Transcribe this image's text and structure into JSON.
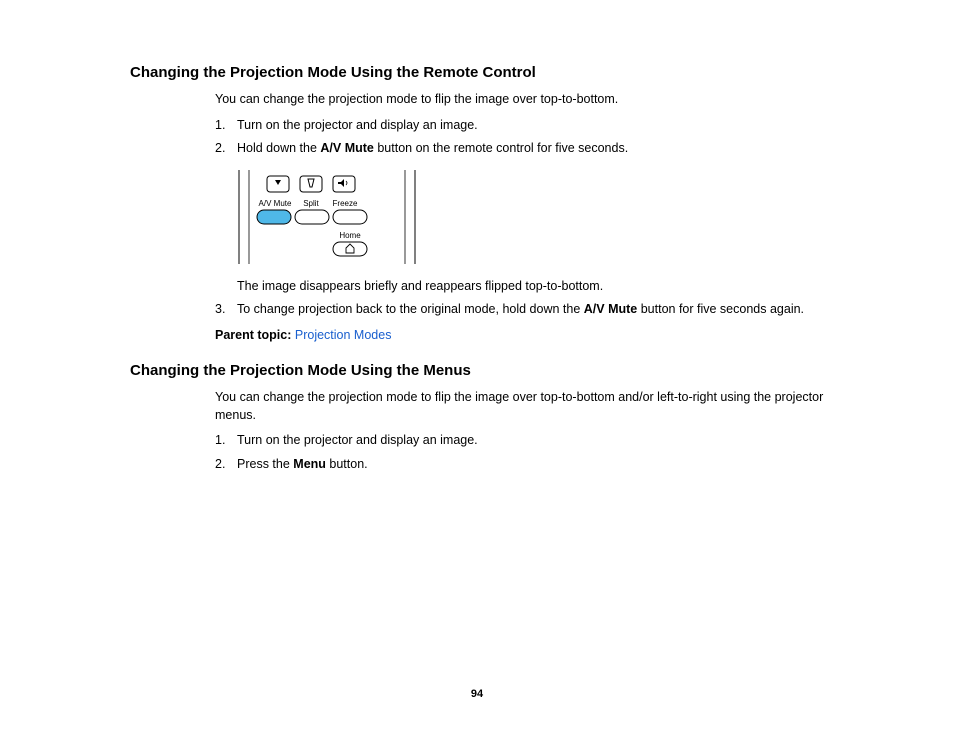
{
  "section1": {
    "heading": "Changing the Projection Mode Using the Remote Control",
    "intro": "You can change the projection mode to flip the image over top-to-bottom.",
    "step1_num": "1.",
    "step1": "Turn on the projector and display an image.",
    "step2_num": "2.",
    "step2_pre": "Hold down the ",
    "step2_bold": "A/V Mute",
    "step2_post": " button on the remote control for five seconds.",
    "after_figure": "The image disappears briefly and reappears flipped top-to-bottom.",
    "step3_num": "3.",
    "step3_pre": "To change projection back to the original mode, hold down the ",
    "step3_bold": "A/V Mute",
    "step3_post": " button for five seconds again.",
    "parent_label": "Parent topic: ",
    "parent_link": "Projection Modes"
  },
  "remote": {
    "avmute": "A/V Mute",
    "split": "Split",
    "freeze": "Freeze",
    "home": "Home"
  },
  "section2": {
    "heading": "Changing the Projection Mode Using the Menus",
    "intro": "You can change the projection mode to flip the image over top-to-bottom and/or left-to-right using the projector menus.",
    "step1_num": "1.",
    "step1": "Turn on the projector and display an image.",
    "step2_num": "2.",
    "step2_pre": "Press the ",
    "step2_bold": "Menu",
    "step2_post": " button."
  },
  "page_number": "94"
}
